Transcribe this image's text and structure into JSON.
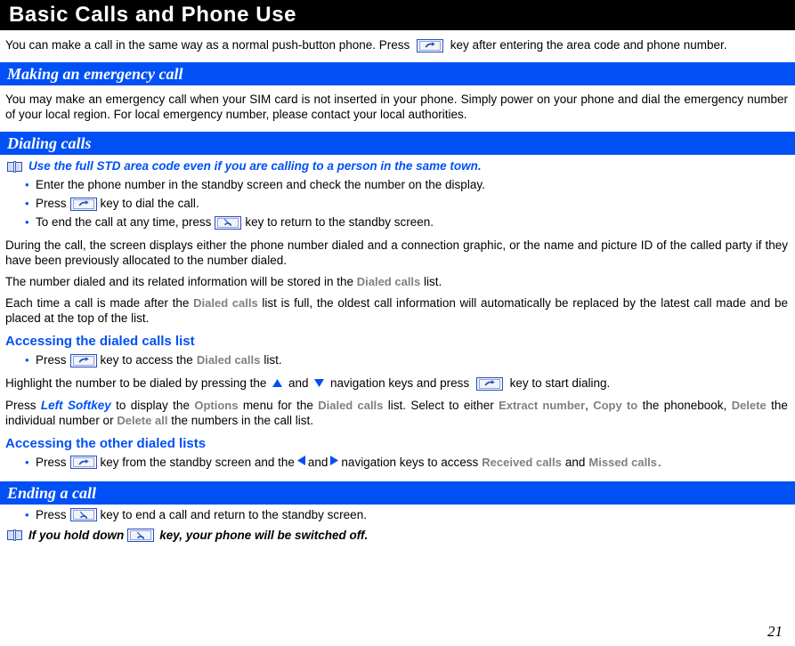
{
  "page": {
    "title": "Basic Calls and Phone Use",
    "number": "21"
  },
  "intro": {
    "text_before_key": "You can make a call in the same way as a normal push-button phone. Press",
    "text_after_key": "key after entering the area code and phone number."
  },
  "sections": [
    {
      "id": "emergency",
      "heading": "Making an emergency call",
      "paragraph": "You may make an emergency call when your SIM card is not inserted in your phone. Simply power on your phone and dial the emergency number of your local region. For local emergency number, please contact your local authorities."
    },
    {
      "id": "dialing",
      "heading": "Dialing calls"
    },
    {
      "id": "ending",
      "heading": "Ending a call"
    }
  ],
  "dialing": {
    "note": "Use the full STD area code even if you are calling to a person in the same town.",
    "bullets": {
      "b1": "Enter the phone number in the standby screen and check the number on the display.",
      "b2_before": "Press",
      "b2_after": "key to dial the call.",
      "b3_before": "To end the call at any time, press",
      "b3_after": "key to return to the standby screen."
    },
    "paragraph_during_call": "During the call, the screen displays either the phone number dialed and a connection graphic, or the name and picture ID of the called party if they have been previously allocated to the number dialed.",
    "paragraph_stored_before": "The number dialed and its related information will be stored in the",
    "paragraph_stored_term": "Dialed calls",
    "paragraph_stored_after": "list.",
    "paragraph_full_before": "Each time a call is made after the",
    "paragraph_full_term": "Dialed calls",
    "paragraph_full_after": "list is full, the oldest call information will automatically be replaced by the latest call made and be placed at the top of the list."
  },
  "accessing_dialed": {
    "subhead": "Accessing the dialed calls list",
    "bullet_before": "Press",
    "bullet_mid": "key to access the",
    "bullet_term": "Dialed calls",
    "bullet_after": "list.",
    "highlight_before": "Highlight the number to be dialed by pressing the",
    "highlight_and": "and",
    "highlight_mid": "navigation keys and press",
    "highlight_after": "key to start dialing.",
    "options_p1": "Press",
    "options_softkey": "Left Softkey",
    "options_p2": "to display the",
    "options_term_options": "Options",
    "options_p3": "menu for the",
    "options_term_dialed": "Dialed calls",
    "options_p4": "list. Select to either",
    "options_term_extract": "Extract number",
    "options_p5": ",",
    "options_term_copy": "Copy to",
    "options_p6": " the phonebook,",
    "options_term_delete": "Delete",
    "options_p7": "the individual number or",
    "options_term_delete_all": "Delete all",
    "options_p8": "the numbers in the call list."
  },
  "accessing_other": {
    "subhead": "Accessing the other dialed lists",
    "bullet_before": "Press",
    "bullet_mid": "key from the standby screen and the",
    "bullet_and": "and",
    "bullet_mid2": "navigation keys to access",
    "bullet_term_received": "Received calls",
    "bullet_and2": "and",
    "bullet_term_missed": "Missed calls",
    "bullet_end": "."
  },
  "ending": {
    "bullet_before": "Press",
    "bullet_after": "key to end a call and return to the standby screen.",
    "note_before": "If you hold down",
    "note_after": "key, your phone will be switched off."
  },
  "icons": {
    "send_key": "send-call-key-icon",
    "end_key": "end-call-key-icon",
    "note_book": "book-note-icon",
    "nav_up": "triangle-up-icon",
    "nav_down": "triangle-down-icon",
    "nav_left": "triangle-left-icon",
    "nav_right": "triangle-right-icon"
  },
  "colors": {
    "accent_blue": "#0050F5",
    "title_bar": "#000000",
    "ui_term_gray": "#808080",
    "key_border": "#2A4FC0"
  }
}
